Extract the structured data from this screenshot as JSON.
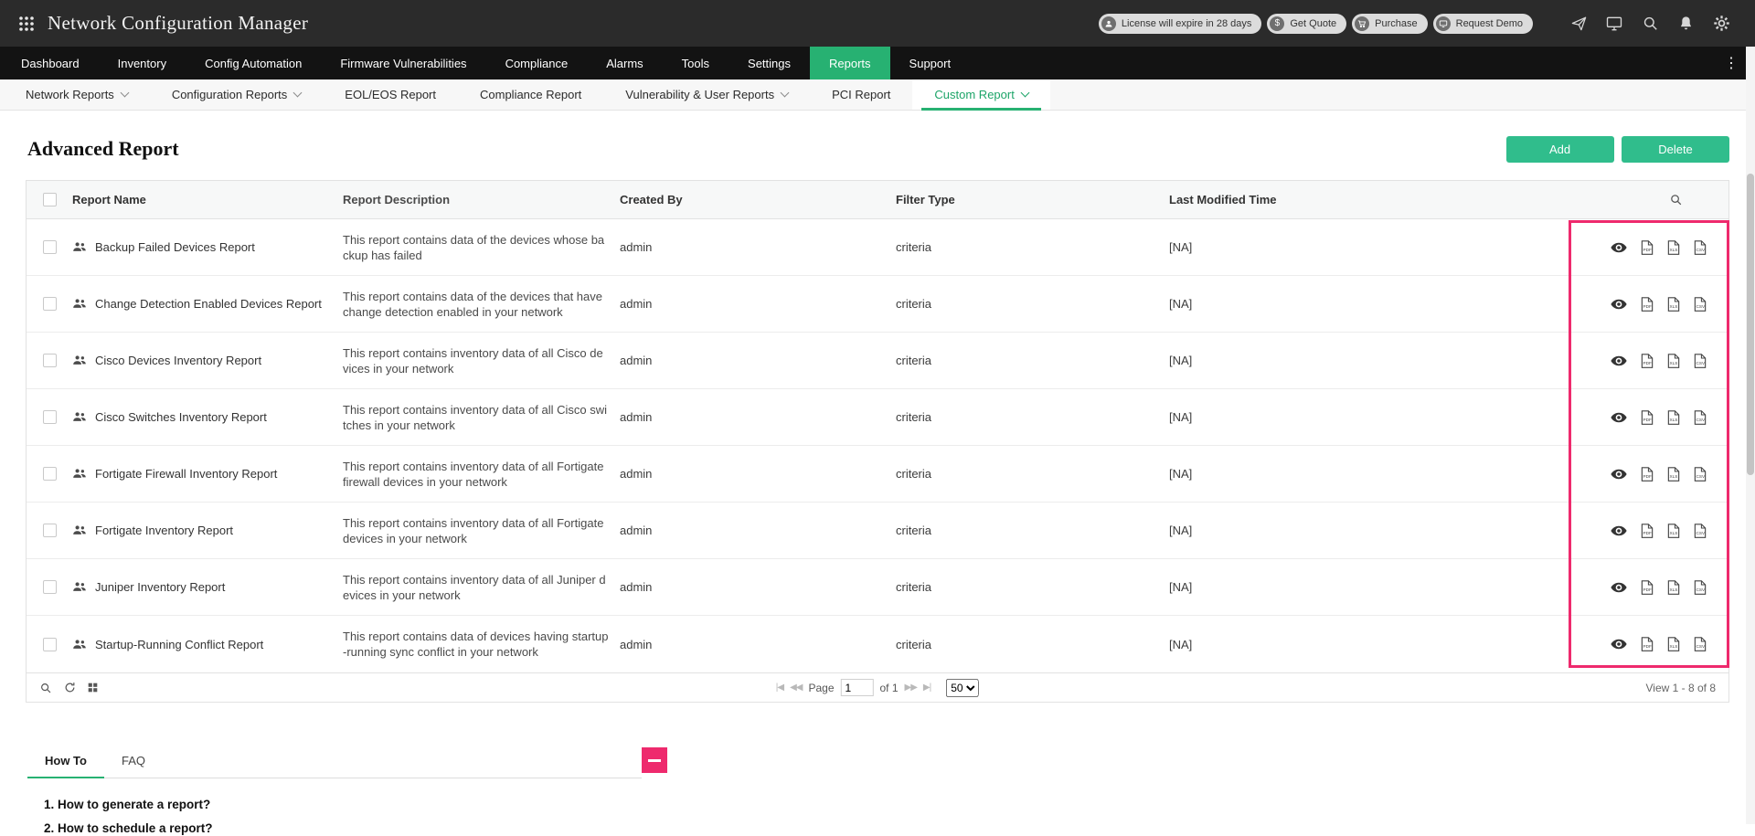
{
  "app": {
    "title": "Network Configuration Manager"
  },
  "topbar": {
    "badges": [
      {
        "label": "License will expire in 28 days"
      },
      {
        "label": "Get Quote"
      },
      {
        "label": "Purchase"
      },
      {
        "label": "Request Demo"
      }
    ]
  },
  "mainnav": {
    "items": [
      {
        "label": "Dashboard"
      },
      {
        "label": "Inventory"
      },
      {
        "label": "Config Automation"
      },
      {
        "label": "Firmware Vulnerabilities"
      },
      {
        "label": "Compliance"
      },
      {
        "label": "Alarms"
      },
      {
        "label": "Tools"
      },
      {
        "label": "Settings"
      },
      {
        "label": "Reports",
        "active": true
      },
      {
        "label": "Support"
      }
    ]
  },
  "subnav": {
    "items": [
      {
        "label": "Network Reports",
        "has_dropdown": true
      },
      {
        "label": "Configuration Reports",
        "has_dropdown": true
      },
      {
        "label": "EOL/EOS Report",
        "has_dropdown": false
      },
      {
        "label": "Compliance Report",
        "has_dropdown": false
      },
      {
        "label": "Vulnerability & User Reports",
        "has_dropdown": true
      },
      {
        "label": "PCI Report",
        "has_dropdown": false
      },
      {
        "label": "Custom Report",
        "has_dropdown": true,
        "active": true
      }
    ]
  },
  "page": {
    "title": "Advanced Report",
    "buttons": {
      "add": "Add",
      "delete": "Delete"
    }
  },
  "table": {
    "headers": {
      "name": "Report Name",
      "description": "Report Description",
      "created_by": "Created By",
      "filter_type": "Filter Type",
      "last_modified": "Last Modified Time"
    },
    "rows": [
      {
        "name": "Backup Failed Devices Report",
        "description": "This report contains data of the devices whose backup has failed",
        "created_by": "admin",
        "filter_type": "criteria",
        "last_modified": "[NA]"
      },
      {
        "name": "Change Detection Enabled Devices Report",
        "description": "This report contains data of the devices that have change detection enabled in your network",
        "created_by": "admin",
        "filter_type": "criteria",
        "last_modified": "[NA]"
      },
      {
        "name": "Cisco Devices Inventory Report",
        "description": "This report contains inventory data of all Cisco devices in your network",
        "created_by": "admin",
        "filter_type": "criteria",
        "last_modified": "[NA]"
      },
      {
        "name": "Cisco Switches Inventory Report",
        "description": "This report contains inventory data of all Cisco switches in your network",
        "created_by": "admin",
        "filter_type": "criteria",
        "last_modified": "[NA]"
      },
      {
        "name": "Fortigate Firewall Inventory Report",
        "description": "This report contains inventory data of all Fortigate firewall devices in your network",
        "created_by": "admin",
        "filter_type": "criteria",
        "last_modified": "[NA]"
      },
      {
        "name": "Fortigate Inventory Report",
        "description": "This report contains inventory data of all Fortigate devices in your network",
        "created_by": "admin",
        "filter_type": "criteria",
        "last_modified": "[NA]"
      },
      {
        "name": "Juniper Inventory Report",
        "description": "This report contains inventory data of all Juniper devices in your network",
        "created_by": "admin",
        "filter_type": "criteria",
        "last_modified": "[NA]"
      },
      {
        "name": "Startup-Running Conflict Report",
        "description": "This report contains data of devices having startup-running sync conflict in your network",
        "created_by": "admin",
        "filter_type": "criteria",
        "last_modified": "[NA]"
      }
    ]
  },
  "pagination": {
    "first": "|◀",
    "prev": "◀◀",
    "next": "▶▶",
    "last": "▶|",
    "page_label": "Page",
    "page_value": "1",
    "of_label": "of 1",
    "page_size": "50",
    "view_label": "View 1 - 8 of 8"
  },
  "help": {
    "tabs": [
      {
        "label": "How To"
      },
      {
        "label": "FAQ"
      }
    ],
    "items": [
      {
        "label": "1. How to generate a report?"
      },
      {
        "label": "2. How to schedule a report?"
      }
    ]
  }
}
